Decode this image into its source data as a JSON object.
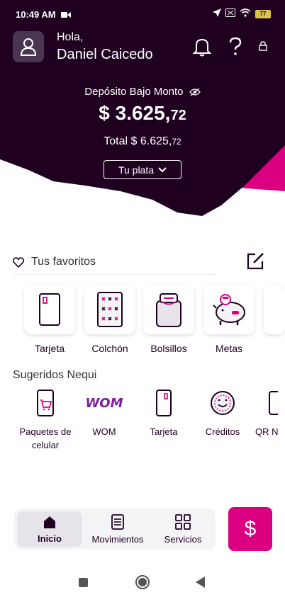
{
  "status_bar": {
    "time": "10:49 AM",
    "battery": "77"
  },
  "header": {
    "greeting": "Hola,",
    "user_name": "Daniel Caicedo",
    "deposit_label": "Depósito Bajo Monto",
    "deposit_amount_main": "$ 3.625,",
    "deposit_amount_cents": "72",
    "total_main": "Total $ 6.625,",
    "total_cents": "72",
    "tu_plata_label": "Tu plata"
  },
  "favorites": {
    "title": "Tus favoritos",
    "items": [
      {
        "label": "Tarjeta",
        "icon": "card-icon"
      },
      {
        "label": "Colchón",
        "icon": "mattress-icon"
      },
      {
        "label": "Bolsillos",
        "icon": "pockets-icon"
      },
      {
        "label": "Metas",
        "icon": "piggy-bank-icon"
      }
    ]
  },
  "suggested": {
    "title": "Sugeridos Nequi",
    "items": [
      {
        "label": "Paquetes de celular",
        "icon": "cellphone-cart-icon"
      },
      {
        "label": "WOM",
        "icon": "wom-logo"
      },
      {
        "label": "Tarjeta",
        "icon": "card-icon"
      },
      {
        "label": "Créditos",
        "icon": "credits-icon"
      },
      {
        "label": "QR N",
        "icon": "qr-icon"
      }
    ],
    "wom_logo_text": "WOM"
  },
  "bottom_nav": {
    "items": [
      {
        "label": "Inicio",
        "icon": "home-icon",
        "active": true
      },
      {
        "label": "Movimientos",
        "icon": "list-icon",
        "active": false
      },
      {
        "label": "Servicios",
        "icon": "grid-icon",
        "active": false
      }
    ],
    "dollar_symbol": "$"
  },
  "colors": {
    "header_bg": "#200020",
    "accent": "#da0081"
  }
}
